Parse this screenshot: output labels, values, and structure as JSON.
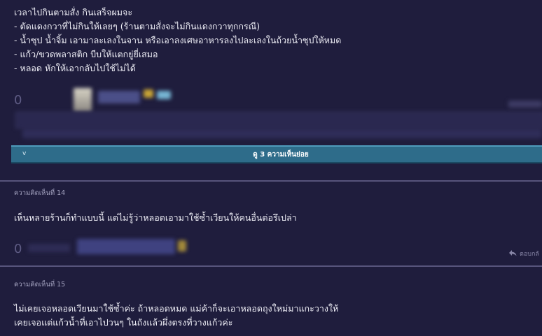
{
  "post": {
    "lines": [
      "เวลาไปกินตามสั่ง กินเสร็จผมจะ",
      "- ตัดแดงกวาที่ไม่กินให้เลยๆ (ร้านตามสั่งจะไม่กินแดงกวาทุกกรณี)",
      "- น้ำซุป น้ำจิ้ม  เอามาละเลงในจาน หรือเอาลงเศษอาหารลงไปละเลงในถ้วยน้ำซุปให้หมด",
      "- แก้ว/ขวดพลาสติก บีบให้แตกยู่ยี่เสมอ",
      "- หลอด หักให้เอากลับไปใช้ไม่ได้"
    ],
    "vote_count": "0"
  },
  "subcomments_toggle": {
    "label": "ดู 3 ความเห็นย่อย"
  },
  "comments": [
    {
      "label": "ความคิดเห็นที่ 14",
      "lines": [
        "เห็นหลายร้านก็ทำแบบนี้ แต่ไม่รู้ว่าหลอดเอามาใช้ซ้ำเวียนให้คนอื่นต่อรึเปล่า"
      ],
      "vote_count": "0",
      "reply_label": "ตอบกลั"
    },
    {
      "label": "ความคิดเห็นที่ 15",
      "lines": [
        "ไม่เคยเจอหลอดเวียนมาใช้ซ้ำค่ะ ถ้าหลอดหมด แม่ค้าก็จะเอาหลอดถุงใหม่มาแกะวางให้",
        "เคยเจอแต่แก้วน้ำที่เอาไปวนๆ ในถังแล้วผึ่งตรงที่วางแก้วค่ะ"
      ]
    }
  ],
  "colors": {
    "background": "#1f1d3d",
    "subcomment_bar": "#2e6c8a",
    "divider": "#57547c"
  },
  "icons": [
    "chevron-down-icon",
    "reply-arrow-icon"
  ]
}
